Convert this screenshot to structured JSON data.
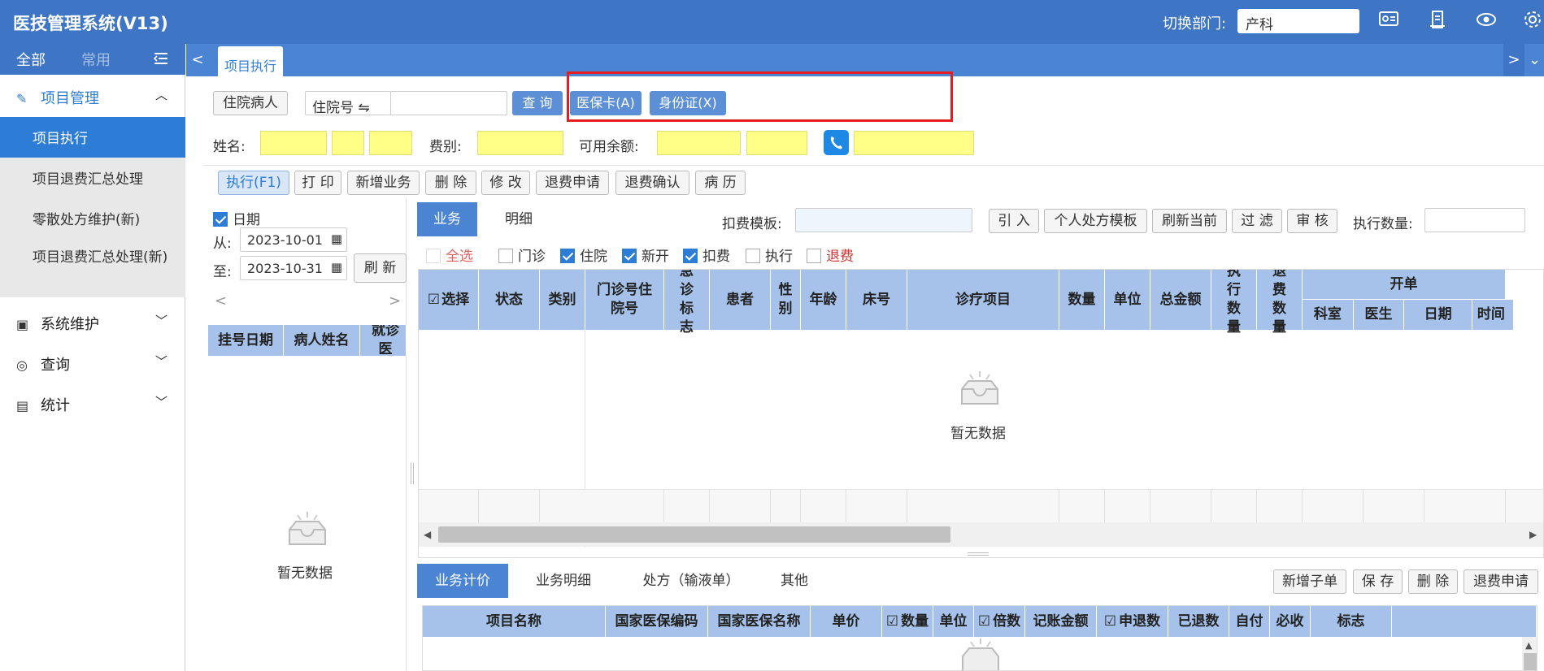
{
  "app": {
    "title": "医技管理系统(V13)",
    "dept_label": "切换部门:",
    "dept_value": "产科"
  },
  "top_icons": [
    "card-icon",
    "document-icon",
    "eye-icon",
    "gear-icon"
  ],
  "sidebar": {
    "tabs": [
      "全部",
      "常用"
    ],
    "groups": [
      {
        "label": "项目管理",
        "icon": "edit-icon",
        "expanded": true,
        "items": [
          "项目执行",
          "项目退费汇总处理",
          "零散处方维护(新)",
          "项目退费汇总处理(新)"
        ]
      },
      {
        "label": "系统维护",
        "icon": "monitor-icon"
      },
      {
        "label": "查询",
        "icon": "search-icon"
      },
      {
        "label": "统计",
        "icon": "chart-icon"
      }
    ]
  },
  "tabs": {
    "active": "项目执行"
  },
  "search": {
    "patient_type": "住院病人",
    "field_type": "住院号 ⇋",
    "field_value": "",
    "query": "查 询",
    "insurance_card": "医保卡(A)",
    "id_card": "身份证(X)"
  },
  "patient": {
    "name_label": "姓名:",
    "fee_label": "费别:",
    "balance_label": "可用余额:"
  },
  "toolbar": [
    "执行(F1)",
    "打 印",
    "新增业务",
    "删 除",
    "修 改",
    "退费申请",
    "退费确认",
    "病 历"
  ],
  "left_panel": {
    "date_label": "日期",
    "from_label": "从:",
    "from_date": "2023-10-01",
    "to_label": "至:",
    "to_date": "2023-10-31",
    "refresh": "刷 新",
    "columns": [
      "挂号日期",
      "病人姓名",
      "就诊医"
    ],
    "empty": "暂无数据"
  },
  "main": {
    "tabs": [
      "业务",
      "明细"
    ],
    "template_label": "扣费模板:",
    "buttons": [
      "引 入",
      "个人处方模板",
      "刷新当前",
      "过 滤",
      "审 核"
    ],
    "exec_qty_label": "执行数量:",
    "filters": [
      {
        "label": "全选",
        "checked": false,
        "color": "#e06060"
      },
      {
        "label": "门诊",
        "checked": false
      },
      {
        "label": "住院",
        "checked": true
      },
      {
        "label": "新开",
        "checked": true
      },
      {
        "label": "扣费",
        "checked": true
      },
      {
        "label": "执行",
        "checked": false
      },
      {
        "label": "退费",
        "checked": false,
        "color": "#d03030"
      }
    ],
    "columns": [
      "选择",
      "状态",
      "类别",
      "门诊号住院号",
      "急诊标志",
      "患者",
      "性别",
      "年龄",
      "床号",
      "诊疗项目",
      "数量",
      "单位",
      "总金额",
      "执行数量",
      "退费数量"
    ],
    "group_header": "开单",
    "group_columns": [
      "科室",
      "医生",
      "日期",
      "时间"
    ],
    "empty": "暂无数据"
  },
  "bottom": {
    "tabs": [
      "业务计价",
      "业务明细",
      "处方（输液单）",
      "其他"
    ],
    "buttons": [
      "新增子单",
      "保 存",
      "删 除",
      "退费申请"
    ],
    "columns": [
      "项目名称",
      "国家医保编码",
      "国家医保名称",
      "单价",
      "数量",
      "单位",
      "倍数",
      "记账金额",
      "申退数",
      "已退数",
      "自付",
      "必收",
      "标志"
    ]
  }
}
